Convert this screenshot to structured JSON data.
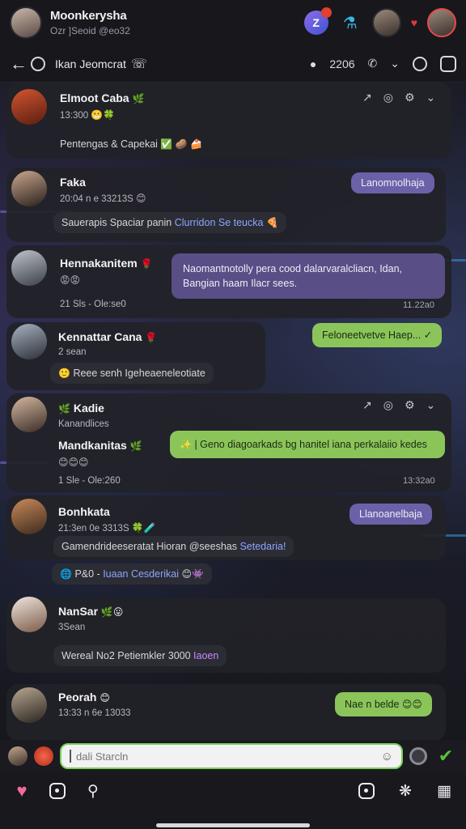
{
  "header": {
    "title": "Moonkerysha",
    "subtitle": "Ozr ]Seoid @eo32",
    "count_badge_glyph": "Z"
  },
  "subheader": {
    "title": "Ikan Jeomcrat",
    "count": "2206"
  },
  "posts": [
    {
      "name": "Elmoot Caba",
      "meta": "13:300",
      "line": "Pentengas & Capekai"
    },
    {
      "name": "Faka",
      "meta": "20:04 n e 33213S",
      "chip": "Sauerapis Spaciar panin ",
      "chip_highlight": "Clurridon Se teucka",
      "reply_bubble": "Lanomnolhaja"
    },
    {
      "name": "Hennakanitem",
      "meta": "21 Sls  -  Ole:se0",
      "reply_bubble": "Naomantnotolly pera cood dalarvaralcliacn, Idan, Bangian haam Ilacr sees.",
      "stamp": "11.22a0"
    },
    {
      "name": "Kennattar Cana",
      "meta": "2 sean",
      "chip": "Reee senh Igeheaeneleotiate",
      "reply_bubble": "Feloneetvetve Haep..."
    },
    {
      "name": "Kadie",
      "meta": "Kanandlices",
      "name2": "Mandkanitas",
      "meta2": "1  Sle  -  Ole:260",
      "reply_bubble": "Geno diagoarkads bg hanitel iana perkalaiio kedes",
      "reply_prefix": "|",
      "stamp": "13:32a0"
    },
    {
      "name": "Bonhkata",
      "meta": "21:3en 0e 3313S",
      "chip": "Gamendrideeseratat  Hioran @seeshas ",
      "chip_highlight": "Setedaria!",
      "chip2_prefix": "P&0  -  ",
      "chip2": "Iuaan Cesderikai",
      "reply_bubble": "Llanoanelbaja"
    },
    {
      "name": "NanSar",
      "meta": "3Sean",
      "chip": "Wereal  No2 Petiemkler  3000  ",
      "chip_highlight": "Iaoen"
    },
    {
      "name": "Peorah",
      "meta": "13:33 n 6e 13033",
      "reply_bubble": "Nae n belde"
    }
  ],
  "composer": {
    "placeholder": "dali Starcln"
  },
  "colors": {
    "accent_green": "#8bc55a",
    "accent_purple": "#6b61a8",
    "online": "#4cb85a",
    "nav_heart": "#f06a9a"
  },
  "icons": {
    "back": "arrow-left-icon",
    "call": "phone-icon",
    "search": "search-icon",
    "send": "check-send-icon"
  }
}
